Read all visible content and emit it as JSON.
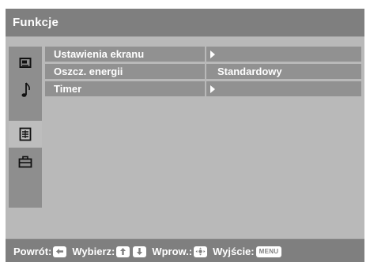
{
  "header": {
    "title": "Funkcje"
  },
  "sidebar": {
    "icons": [
      {
        "name": "picture-icon",
        "active": false
      },
      {
        "name": "sound-icon",
        "active": false
      },
      {
        "name": "features-icon",
        "active": true
      },
      {
        "name": "setup-icon",
        "active": false
      }
    ]
  },
  "menu": {
    "items": [
      {
        "label": "Ustawienia ekranu",
        "value": "",
        "has_submenu": true
      },
      {
        "label": "Oszcz. energii",
        "value": "Standardowy",
        "has_submenu": false
      },
      {
        "label": "Timer",
        "value": "",
        "has_submenu": true
      }
    ]
  },
  "footer": {
    "back_label": "Powrót:",
    "select_label": "Wybierz:",
    "enter_label": "Wprow.:",
    "exit_label": "Wyjście:",
    "menu_key": "MENU"
  },
  "colors": {
    "header_bg": "#7f7f7f",
    "body_bg": "#b9b9b9",
    "item_bg": "#919191",
    "sidebar_bg": "#8e8e8e",
    "text": "#ffffff"
  }
}
